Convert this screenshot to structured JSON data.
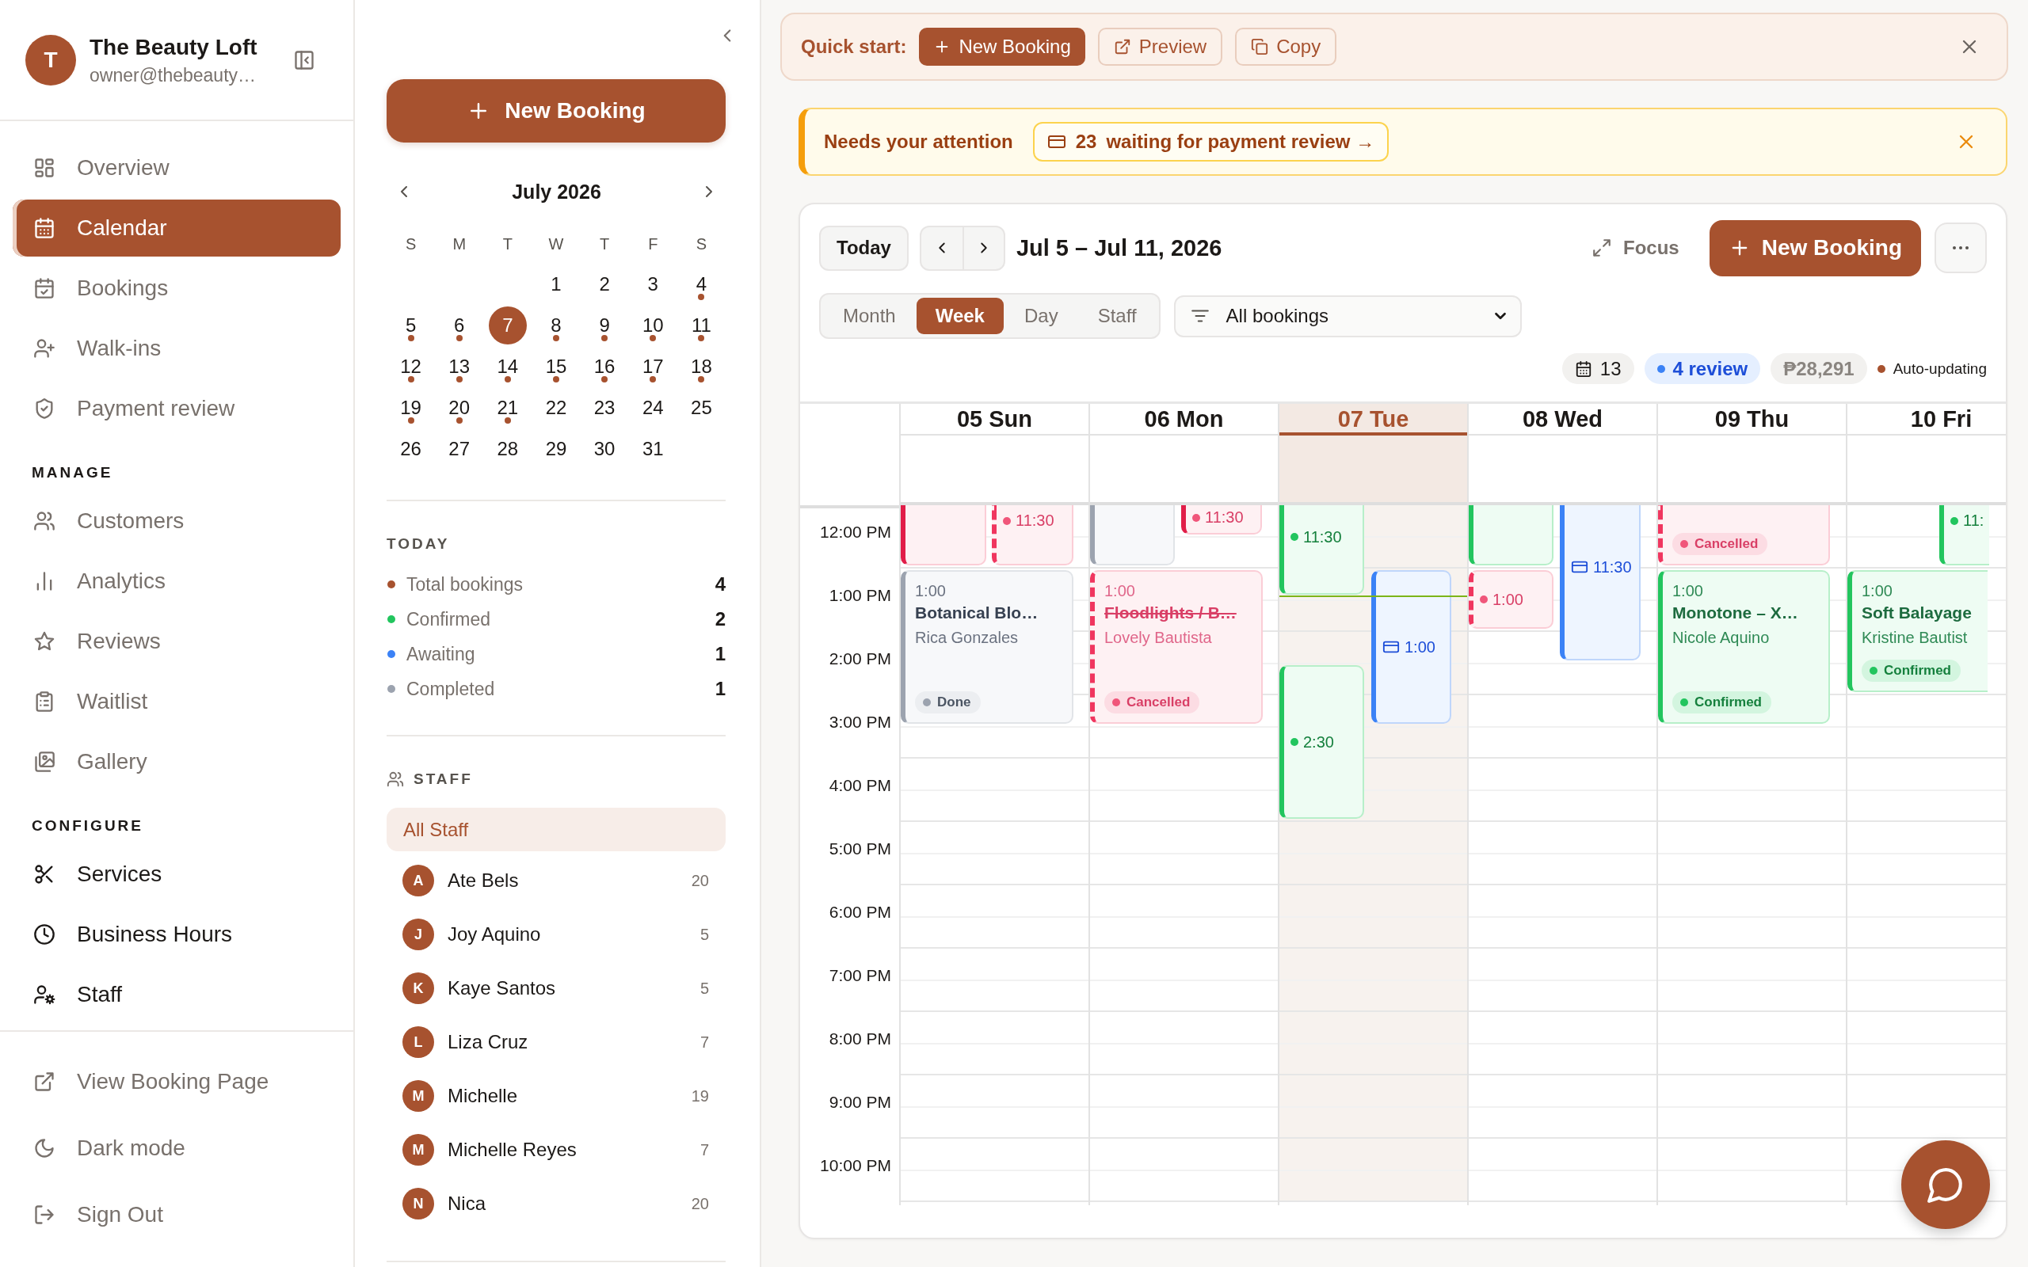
{
  "sidebar": {
    "brand": {
      "initial": "T",
      "name": "The Beauty Loft",
      "email": "owner@thebeauty…"
    },
    "sections": [
      {
        "kind": "muted",
        "items": [
          {
            "label": "Overview",
            "selected": false
          },
          {
            "label": "Calendar",
            "selected": true
          },
          {
            "label": "Bookings",
            "selected": false
          },
          {
            "label": "Walk-ins",
            "selected": false
          },
          {
            "label": "Payment review",
            "selected": false
          }
        ]
      },
      {
        "kind": "muted",
        "heading": "MANAGE",
        "items": [
          {
            "label": "Customers",
            "selected": false
          },
          {
            "label": "Analytics",
            "selected": false
          },
          {
            "label": "Reviews",
            "selected": false
          },
          {
            "label": "Waitlist",
            "selected": false
          },
          {
            "label": "Gallery",
            "selected": false
          }
        ]
      },
      {
        "kind": "strong",
        "heading": "CONFIGURE",
        "items": [
          {
            "label": "Services",
            "selected": false
          },
          {
            "label": "Business Hours",
            "selected": false
          },
          {
            "label": "Staff",
            "selected": false
          }
        ]
      }
    ],
    "footer": [
      {
        "label": "View Booking Page"
      },
      {
        "label": "Dark mode"
      },
      {
        "label": "Sign Out"
      }
    ]
  },
  "panel": {
    "new_booking": "New Booking",
    "month": "July 2026",
    "weekdays": [
      "S",
      "M",
      "T",
      "W",
      "T",
      "F",
      "S"
    ],
    "weeks": [
      [
        {
          "date": "1",
          "has_bookings": false,
          "selected": false
        },
        {
          "date": "2",
          "has_bookings": false,
          "selected": false
        },
        {
          "date": "3",
          "has_bookings": false,
          "selected": false
        },
        {
          "date": "4",
          "has_bookings": true,
          "selected": false
        }
      ],
      [
        {
          "date": "5",
          "has_bookings": true,
          "selected": false
        },
        {
          "date": "6",
          "has_bookings": true,
          "selected": false
        },
        {
          "date": "7",
          "has_bookings": false,
          "selected": true
        },
        {
          "date": "8",
          "has_bookings": true,
          "selected": false
        },
        {
          "date": "9",
          "has_bookings": true,
          "selected": false
        },
        {
          "date": "10",
          "has_bookings": true,
          "selected": false
        },
        {
          "date": "11",
          "has_bookings": true,
          "selected": false
        }
      ],
      [
        {
          "date": "12",
          "has_bookings": true,
          "selected": false
        },
        {
          "date": "13",
          "has_bookings": true,
          "selected": false
        },
        {
          "date": "14",
          "has_bookings": true,
          "selected": false
        },
        {
          "date": "15",
          "has_bookings": true,
          "selected": false
        },
        {
          "date": "16",
          "has_bookings": true,
          "selected": false
        },
        {
          "date": "17",
          "has_bookings": true,
          "selected": false
        },
        {
          "date": "18",
          "has_bookings": true,
          "selected": false
        }
      ],
      [
        {
          "date": "19",
          "has_bookings": true,
          "selected": false
        },
        {
          "date": "20",
          "has_bookings": true,
          "selected": false
        },
        {
          "date": "21",
          "has_bookings": true,
          "selected": false
        },
        {
          "date": "22",
          "has_bookings": false,
          "selected": false
        },
        {
          "date": "23",
          "has_bookings": false,
          "selected": false
        },
        {
          "date": "24",
          "has_bookings": false,
          "selected": false
        },
        {
          "date": "25",
          "has_bookings": false,
          "selected": false
        }
      ],
      [
        {
          "date": "26",
          "has_bookings": false,
          "selected": false
        },
        {
          "date": "27",
          "has_bookings": false,
          "selected": false
        },
        {
          "date": "28",
          "has_bookings": false,
          "selected": false
        },
        {
          "date": "29",
          "has_bookings": false,
          "selected": false
        },
        {
          "date": "30",
          "has_bookings": false,
          "selected": false
        },
        {
          "date": "31",
          "has_bookings": false,
          "selected": false
        }
      ]
    ],
    "today": {
      "title": "TODAY",
      "stats": [
        {
          "label": "Total bookings",
          "value": "4",
          "color": "#a7522f"
        },
        {
          "label": "Confirmed",
          "value": "2",
          "color": "#22c55e"
        },
        {
          "label": "Awaiting",
          "value": "1",
          "color": "#3b82f6"
        },
        {
          "label": "Completed",
          "value": "1",
          "color": "#9ca3af"
        }
      ]
    },
    "staff": {
      "title": "STAFF",
      "all": {
        "label": "All Staff",
        "selected": true
      },
      "members": [
        {
          "initial": "A",
          "name": "Ate Bels",
          "count": "20",
          "selected": false
        },
        {
          "initial": "J",
          "name": "Joy Aquino",
          "count": "5",
          "selected": false
        },
        {
          "initial": "K",
          "name": "Kaye Santos",
          "count": "5",
          "selected": false
        },
        {
          "initial": "L",
          "name": "Liza Cruz",
          "count": "7",
          "selected": false
        },
        {
          "initial": "M",
          "name": "Michelle",
          "count": "19",
          "selected": false
        },
        {
          "initial": "M",
          "name": "Michelle Reyes",
          "count": "7",
          "selected": false
        },
        {
          "initial": "N",
          "name": "Nica",
          "count": "20",
          "selected": false
        }
      ]
    }
  },
  "quick_start": {
    "label": "Quick start:",
    "actions": [
      {
        "label": "New Booking",
        "kind": "primary"
      },
      {
        "label": "Preview",
        "kind": "outline"
      },
      {
        "label": "Copy",
        "kind": "outline"
      }
    ]
  },
  "attention": {
    "title": "Needs your attention",
    "count": "23",
    "text": "waiting for payment review →"
  },
  "calendar": {
    "today_button": "Today",
    "range": "Jul 5 – Jul 11, 2026",
    "focus": "Focus",
    "new_booking": "New Booking",
    "views": [
      {
        "label": "Month",
        "selected": false
      },
      {
        "label": "Week",
        "selected": true
      },
      {
        "label": "Day",
        "selected": false
      },
      {
        "label": "Staff",
        "selected": false
      }
    ],
    "filter": {
      "value": "All bookings"
    },
    "summary": {
      "count": "13",
      "review": "4 review",
      "revenue": "₱28,291",
      "live": "Auto-updating"
    },
    "hours": [
      "12:00 PM",
      "1:00 PM",
      "2:00 PM",
      "3:00 PM",
      "4:00 PM",
      "5:00 PM",
      "6:00 PM",
      "7:00 PM",
      "8:00 PM",
      "9:00 PM",
      "10:00 PM"
    ],
    "days": [
      {
        "label": "05 Sun",
        "today": false,
        "events": [
          {
            "kind": "declined"
          },
          {
            "kind": "cancelled",
            "time": "11:30"
          },
          {
            "kind": "done",
            "time": "1:00",
            "title": "Botanical Blo…",
            "customer": "Rica Gonzales",
            "badge": "Done"
          }
        ]
      },
      {
        "label": "06 Mon",
        "today": false,
        "events": [
          {
            "kind": "done"
          },
          {
            "kind": "declined",
            "time": "11:30"
          },
          {
            "kind": "cancelled",
            "time": "1:00",
            "title": "Floodlights / B…",
            "customer": "Lovely Bautista",
            "badge": "Cancelled"
          }
        ]
      },
      {
        "label": "07 Tue",
        "today": true,
        "events": [
          {
            "kind": "confirmed",
            "time": "11:30"
          },
          {
            "kind": "review",
            "time": "1:00"
          },
          {
            "kind": "confirmed",
            "time": "2:30"
          }
        ]
      },
      {
        "label": "08 Wed",
        "today": false,
        "events": [
          {
            "kind": "confirmed"
          },
          {
            "kind": "cancelled",
            "time": "1:00"
          },
          {
            "kind": "review",
            "time": "11:30"
          }
        ]
      },
      {
        "label": "09 Thu",
        "today": false,
        "events": [
          {
            "kind": "cancelled",
            "badge": "Cancelled"
          },
          {
            "kind": "confirmed",
            "time": "1:00",
            "title": "Monotone – X…",
            "customer": "Nicole Aquino",
            "badge": "Confirmed"
          }
        ]
      },
      {
        "label": "10 Fri",
        "today": false,
        "events": [
          {
            "kind": "confirmed",
            "time": "11:"
          },
          {
            "kind": "confirmed",
            "time": "1:00",
            "title": "Soft Balayage",
            "customer": "Kristine Bautist",
            "badge": "Confirmed"
          }
        ]
      }
    ]
  }
}
